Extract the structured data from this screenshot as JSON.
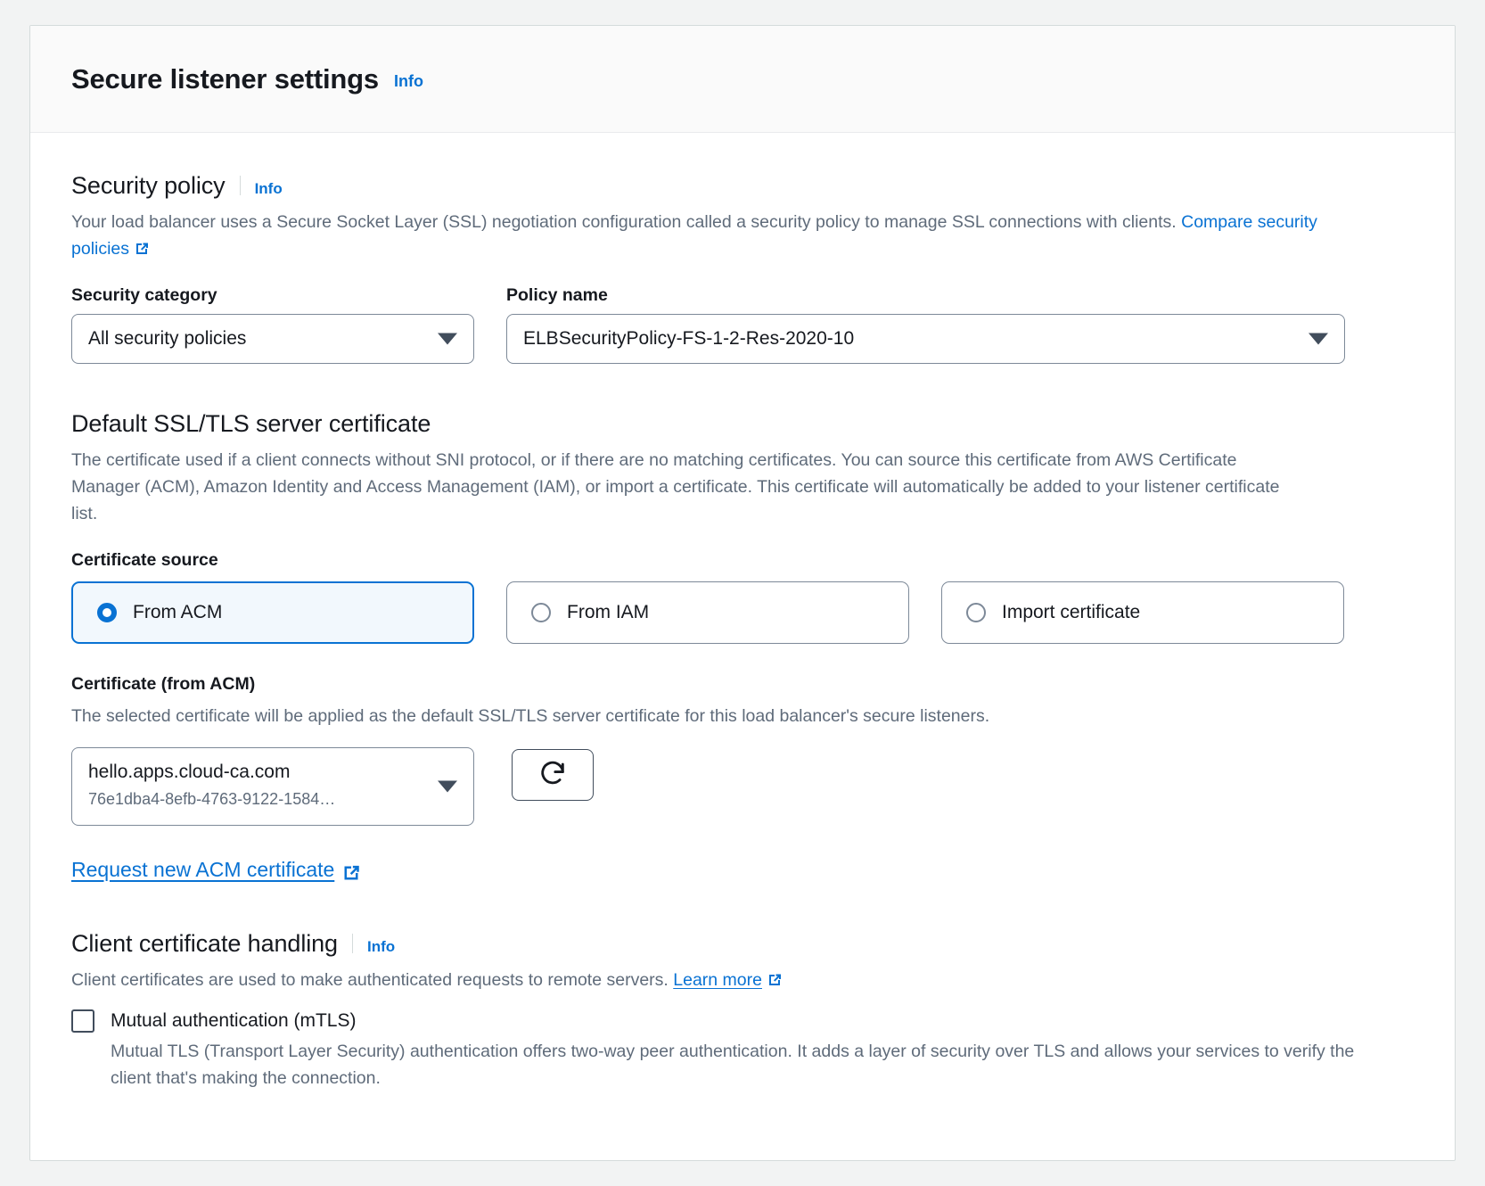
{
  "panel": {
    "title": "Secure listener settings",
    "info_label": "Info"
  },
  "security_policy": {
    "title": "Security policy",
    "info_label": "Info",
    "description_part1": "Your load balancer uses a Secure Socket Layer (SSL) negotiation configuration called a security policy to manage SSL connections with clients. ",
    "compare_link": "Compare security policies",
    "category_label": "Security category",
    "category_value": "All security policies",
    "policy_label": "Policy name",
    "policy_value": "ELBSecurityPolicy-FS-1-2-Res-2020-10"
  },
  "default_certificate": {
    "title": "Default SSL/TLS server certificate",
    "description": "The certificate used if a client connects without SNI protocol, or if there are no matching certificates. You can source this certificate from AWS Certificate Manager (ACM), Amazon Identity and Access Management (IAM), or import a certificate. This certificate will automatically be added to your listener certificate list.",
    "source_label": "Certificate source",
    "sources": [
      {
        "label": "From ACM",
        "selected": true
      },
      {
        "label": "From IAM",
        "selected": false
      },
      {
        "label": "Import certificate",
        "selected": false
      }
    ],
    "cert_label": "Certificate (from ACM)",
    "cert_description": "The selected certificate will be applied as the default SSL/TLS server certificate for this load balancer's secure listeners.",
    "cert_value_primary": "hello.apps.cloud-ca.com",
    "cert_value_secondary": "76e1dba4-8efb-4763-9122-1584…",
    "refresh_icon": "refresh-icon",
    "request_link": "Request new ACM certificate"
  },
  "client_certificate": {
    "title": "Client certificate handling",
    "info_label": "Info",
    "description_part1": "Client certificates are used to make authenticated requests to remote servers. ",
    "learn_more_link": "Learn more",
    "mtls_label": "Mutual authentication (mTLS)",
    "mtls_checked": false,
    "mtls_description": "Mutual TLS (Transport Layer Security) authentication offers two-way peer authentication. It adds a layer of security over TLS and allows your services to verify the client that's making the connection."
  },
  "colors": {
    "link": "#0972d3",
    "selected_tile_bg": "#f2f8fd",
    "text": "#16191f",
    "muted_text": "#5f6b7a",
    "border": "#7d8998"
  }
}
